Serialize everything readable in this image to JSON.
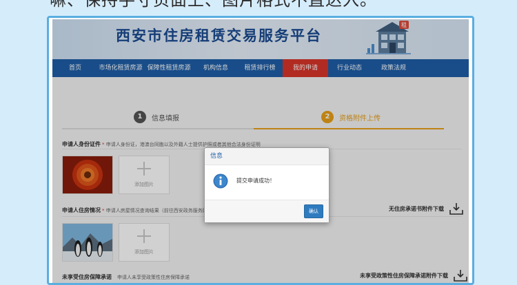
{
  "top_text": "嘛、保持手寸页面上、图片格式不直达入。",
  "banner": {
    "title": "西安市住房租赁交易服务平台",
    "house_badge": "租"
  },
  "nav": {
    "items": [
      {
        "label": "首页"
      },
      {
        "label": "市场化租赁房源"
      },
      {
        "label": "保障性租赁房源"
      },
      {
        "label": "机构信息"
      },
      {
        "label": "租赁排行榜"
      },
      {
        "label": "我的申请"
      },
      {
        "label": "行业动态"
      },
      {
        "label": "政策法规"
      }
    ],
    "active_index": 5
  },
  "steps": [
    {
      "num": "1",
      "label": "信息填报"
    },
    {
      "num": "2",
      "label": "资格附件上传"
    }
  ],
  "sections": {
    "id_card": {
      "title": "申请人身份证件",
      "hint_star": "*",
      "hint": "申请人身份证，港澳台同胞以及外籍人士提供护照或者其他合法身份证明",
      "add_label": "添加图片"
    },
    "housing": {
      "title": "申请人住房情况",
      "hint_star": "*",
      "hint": "申请人房屋情况查询结果（前往西安政务服务网",
      "add_label": "添加图片",
      "download_label": "无住房承诺书附件下载"
    },
    "no_support": {
      "title": "未享受住房保障承诺",
      "hint": "申请人未享受政策性住房保障承诺",
      "download_label": "未享受政策性住房保障承诺附件下载"
    }
  },
  "modal": {
    "title": "信息",
    "message": "提交申请成功！",
    "ok_label": "确认"
  },
  "colors": {
    "nav_bg": "#1f5fa8",
    "nav_active": "#d8352b",
    "step_done": "#555555",
    "step_active": "#e8a019"
  }
}
